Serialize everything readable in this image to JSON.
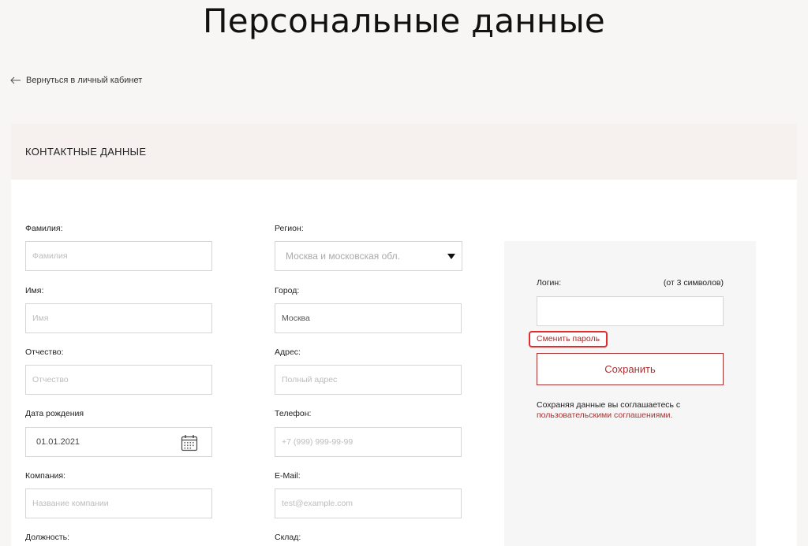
{
  "page": {
    "title": "Персональные данные"
  },
  "back": {
    "label": "Вернуться в личный кабинет"
  },
  "section": {
    "title": "КОНТАКТНЫЕ ДАННЫЕ"
  },
  "left_fields": [
    {
      "label": "Фамилия:",
      "placeholder": "Фамилия"
    },
    {
      "label": "Имя:",
      "placeholder": "Имя"
    },
    {
      "label": "Отчество:",
      "placeholder": "Отчество"
    },
    {
      "label": "Дата рождения",
      "value": "01.01.2021"
    },
    {
      "label": "Компания:",
      "placeholder": "Название компании"
    },
    {
      "label": "Должность:"
    }
  ],
  "right_fields": [
    {
      "label": "Регион:",
      "value": "Москва и московская обл."
    },
    {
      "label": "Город:",
      "value": "Москва"
    },
    {
      "label": "Адрес:",
      "placeholder": "Полный адрес"
    },
    {
      "label": "Телефон:",
      "placeholder": "+7 (999) 999-99-99"
    },
    {
      "label": "E-Mail:",
      "placeholder": "test@example.com"
    },
    {
      "label": "Склад:"
    }
  ],
  "account": {
    "login_label": "Логин:",
    "login_hint": "(от 3 символов)",
    "change_password": "Сменить пароль",
    "save": "Сохранить",
    "agreement_text": "Сохраняя данные вы соглашаетесь с",
    "agreement_link": "пользовательскими соглашениями."
  },
  "colors": {
    "accent": "#a83232",
    "highlight": "#e32d2d",
    "header_bg": "#f6f1ee"
  }
}
